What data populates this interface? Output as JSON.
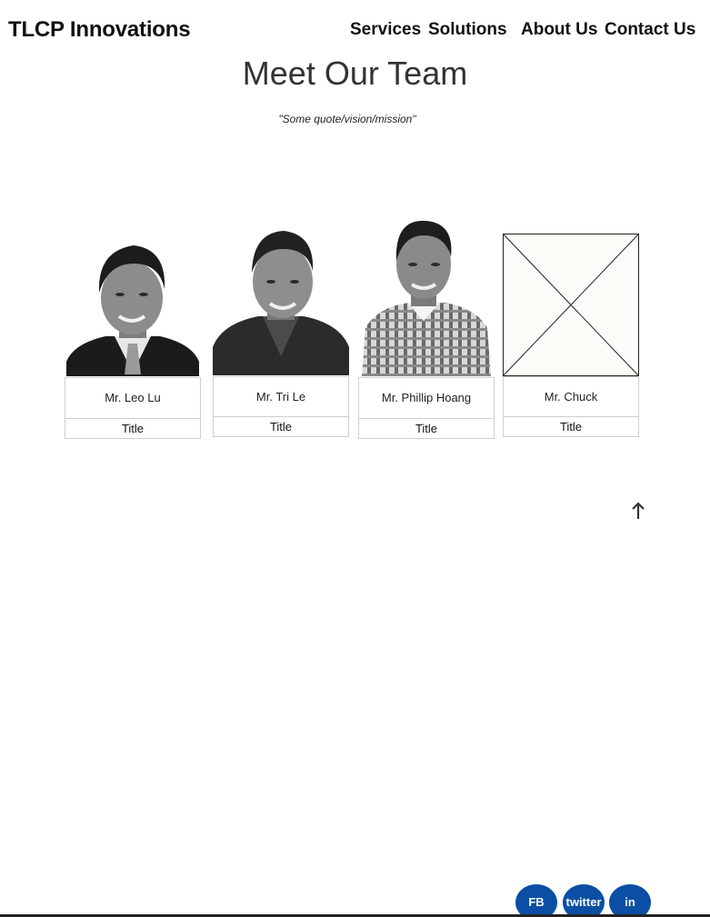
{
  "header": {
    "brand": "TLCP Innovations",
    "nav": {
      "services": "Services",
      "solutions": "Solutions",
      "about": "About Us",
      "contact": "Contact Us"
    }
  },
  "main": {
    "title": "Meet Our Team",
    "quote": "\"Some quote/vision/mission\"",
    "team": [
      {
        "name": "Mr. Leo Lu",
        "title": "Title",
        "photo": "portrait-photo"
      },
      {
        "name": "Mr. Tri Le",
        "title": "Title",
        "photo": "portrait-photo"
      },
      {
        "name": "Mr. Phillip Hoang",
        "title": "Title",
        "photo": "portrait-photo"
      },
      {
        "name": "Mr. Chuck",
        "title": "Title",
        "photo": "image-placeholder"
      }
    ]
  },
  "scroll_top_icon": "arrow-up-icon",
  "social": {
    "fb": "FB",
    "twitter": "twitter",
    "linkedin": "in"
  },
  "colors": {
    "social_bg": "#0a4fa3",
    "card_border": "#cfcfcf",
    "title_text": "#333333"
  }
}
